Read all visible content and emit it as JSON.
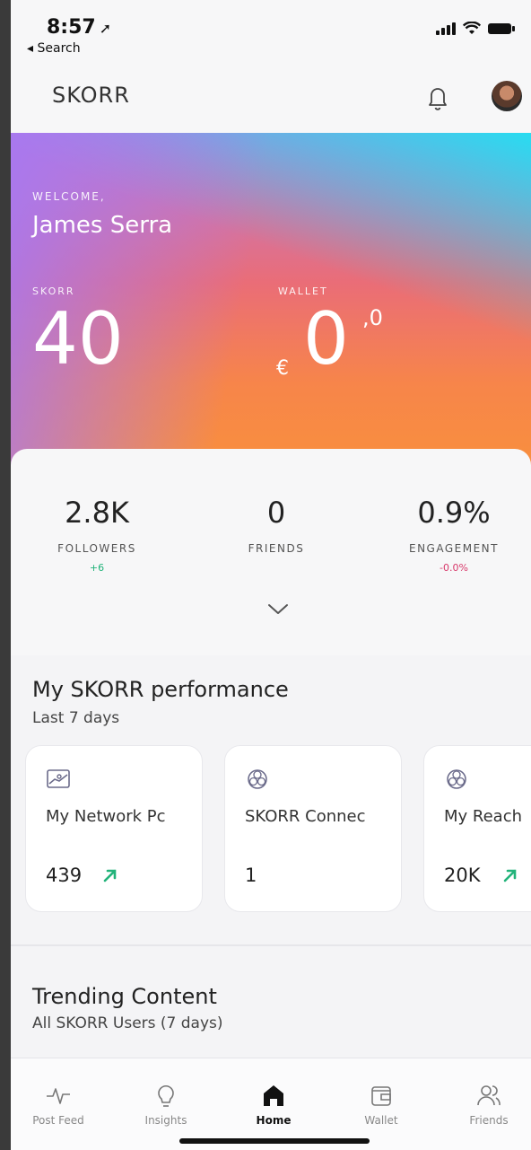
{
  "status": {
    "time": "8:57",
    "back_label": "Search"
  },
  "header": {
    "brand": "SKORR"
  },
  "hero": {
    "welcome_label": "WELCOME,",
    "user_name": "James Serra",
    "skorr_label": "SKORR",
    "skorr_value": "40",
    "wallet_label": "WALLET",
    "wallet_currency": "€",
    "wallet_value": "0",
    "wallet_decimal": ",0"
  },
  "stats": [
    {
      "value": "2.8K",
      "label": "FOLLOWERS",
      "delta": "+6"
    },
    {
      "value": "0",
      "label": "FRIENDS",
      "delta": ""
    },
    {
      "value": "0.9%",
      "label": "ENGAGEMENT",
      "delta": "-0.0%"
    }
  ],
  "performance": {
    "title": "My SKORR performance",
    "subtitle": "Last 7 days",
    "cards": [
      {
        "icon": "network-chart-icon",
        "title": "My Network Pc",
        "value": "439",
        "trend": "up"
      },
      {
        "icon": "connections-icon",
        "title": "SKORR Connec",
        "value": "1",
        "trend": ""
      },
      {
        "icon": "connections-icon",
        "title": "My Reach",
        "value": "20K",
        "trend": "up"
      }
    ]
  },
  "trending": {
    "title": "Trending Content",
    "subtitle": "All SKORR Users (7 days)"
  },
  "nav": [
    {
      "label": "Post Feed",
      "icon": "pulse-icon"
    },
    {
      "label": "Insights",
      "icon": "lightbulb-icon"
    },
    {
      "label": "Home",
      "icon": "home-icon",
      "active": true
    },
    {
      "label": "Wallet",
      "icon": "wallet-icon"
    },
    {
      "label": "Friends",
      "icon": "friends-icon"
    }
  ],
  "colors": {
    "positive": "#22b37a",
    "negative": "#d8386a"
  }
}
